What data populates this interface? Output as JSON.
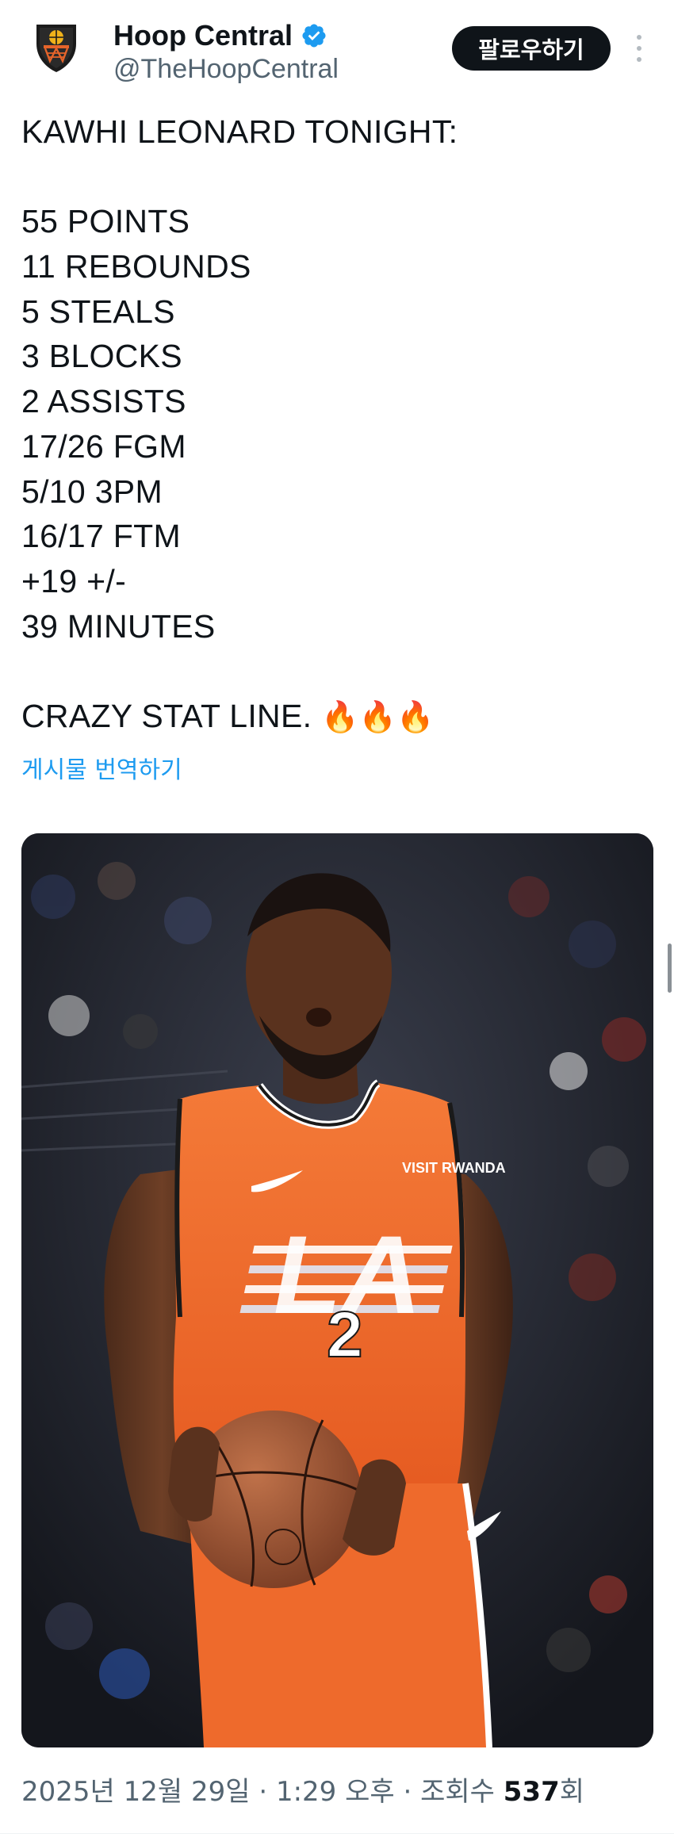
{
  "author": {
    "display_name": "Hoop Central",
    "handle": "@TheHoopCentral",
    "verified": true,
    "avatar_icon": "hoop-central-logo-icon"
  },
  "actions": {
    "follow_label": "팔로우하기",
    "more_icon": "more-vertical-icon"
  },
  "tweet": {
    "headline": "KAWHI LEONARD TONIGHT:",
    "stats": [
      "55 POINTS",
      "11 REBOUNDS",
      "5 STEALS",
      "3 BLOCKS",
      "2 ASSISTS",
      "17/26 FGM",
      "5/10 3PM",
      "16/17 FTM",
      "+19 +/-",
      "39 MINUTES"
    ],
    "closing": "CRAZY STAT LINE.",
    "closing_emoji": "🔥🔥🔥",
    "translate_label": "게시물 번역하기"
  },
  "media": {
    "jersey_sponsor": "VISIT RWANDA",
    "jersey_team": "LA",
    "jersey_number": "2"
  },
  "meta": {
    "date": "2025년 12월 29일",
    "separator": "·",
    "time": "1:29 오후",
    "views_label": "조회수",
    "views_count": "537",
    "views_suffix": "회"
  },
  "colors": {
    "link": "#1d9bf0",
    "verified": "#1d9bf0",
    "text_primary": "#0f1419",
    "text_secondary": "#536471",
    "button_bg": "#0f1419",
    "jersey_orange": "#f26a2b"
  }
}
